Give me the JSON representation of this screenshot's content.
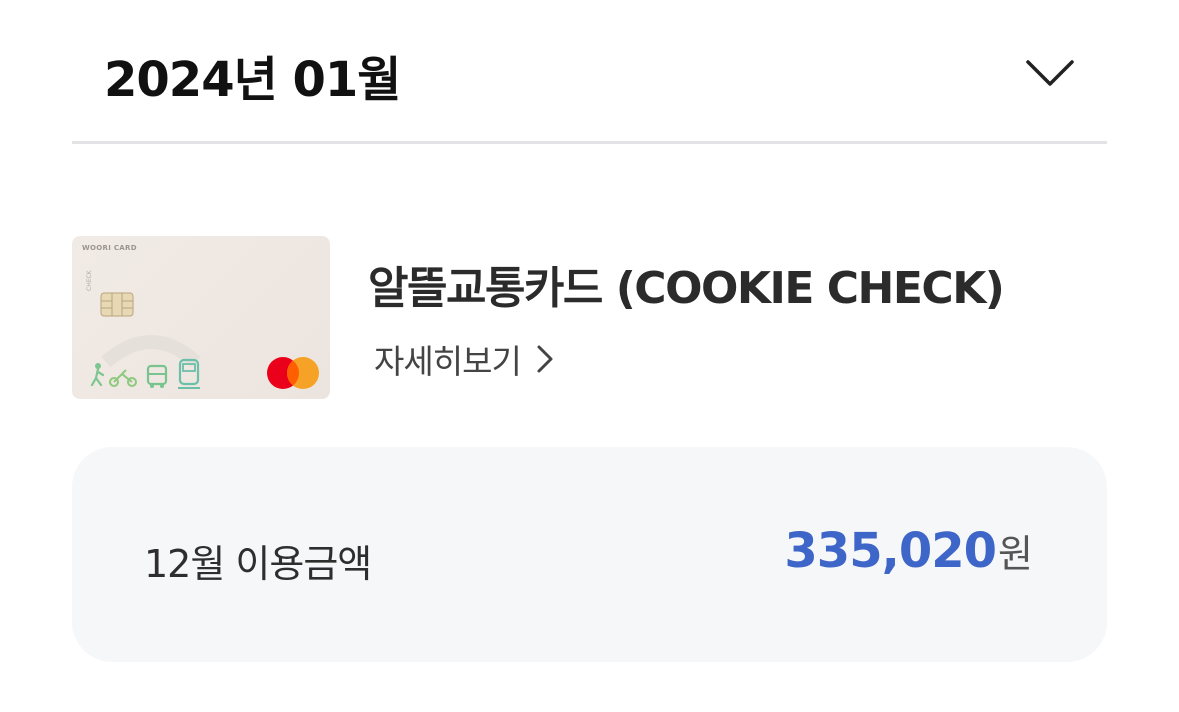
{
  "header": {
    "month_title": "2024년 01월",
    "toggle_icon": "chevron-down-icon"
  },
  "card": {
    "brand_text": "WOORI CARD",
    "check_text": "CHECK",
    "name": "알뜰교통카드 (COOKIE CHECK)",
    "detail_label": "자세히보기",
    "detail_icon": "chevron-right-icon",
    "network_icon": "mastercard-logo",
    "colors": {
      "card_bg": "#f1ebe6",
      "art_green": "#7cc68f",
      "art_teal": "#6cbfa9"
    }
  },
  "usage": {
    "label": "12월 이용금액",
    "amount": "335,020",
    "unit": "원",
    "amount_color": "#3d66c8",
    "panel_bg": "#f6f7f9"
  }
}
